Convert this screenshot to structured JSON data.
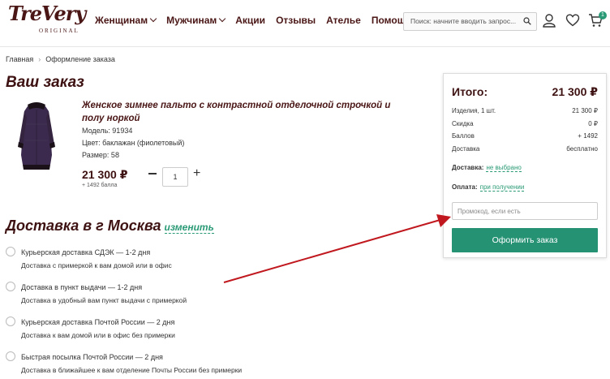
{
  "header": {
    "logo_text": "TreVery",
    "logo_sub": "ORIGINAL",
    "nav": [
      {
        "label": "Женщинам",
        "has_menu": true
      },
      {
        "label": "Мужчинам",
        "has_menu": true
      },
      {
        "label": "Акции",
        "has_menu": false
      },
      {
        "label": "Отзывы",
        "has_menu": false
      },
      {
        "label": "Ателье",
        "has_menu": false
      },
      {
        "label": "Помощь",
        "has_menu": true
      }
    ],
    "search_placeholder": "Поиск: начните вводить запрос...",
    "cart_count": "1",
    "icons": [
      "search-icon",
      "user-icon",
      "heart-icon",
      "cart-icon"
    ]
  },
  "breadcrumb": {
    "home": "Главная",
    "current": "Оформление заказа"
  },
  "order": {
    "title": "Ваш заказ",
    "product_name": "Женское зимнее пальто с контрастной отделочной строчкой и полу норкой",
    "model": "Модель: 91934",
    "color": "Цвет: баклажан (фиолетовый)",
    "size": "Размер: 58",
    "price": "21 300 ₽",
    "bonus": "+ 1492 балла",
    "quantity": "1"
  },
  "delivery": {
    "title": "Доставка в г Москва",
    "change_link": "изменить",
    "options": [
      {
        "title": "Курьерская доставка СДЭК — 1-2 дня",
        "desc": "Доставка с примеркой к вам домой или в офис"
      },
      {
        "title": "Доставка в пункт выдачи — 1-2 дня",
        "desc": "Доставка в удобный вам пункт выдачи с примеркой"
      },
      {
        "title": "Курьерская доставка Почтой России — 2 дня",
        "desc": "Доставка к вам домой или в офис без примерки"
      },
      {
        "title": "Быстрая посылка Почтой России — 2 дня",
        "desc": "Доставка в ближайшее к вам отделение Почты России без примерки"
      }
    ]
  },
  "summary": {
    "total_label": "Итого:",
    "total_value": "21 300 ₽",
    "rows": [
      {
        "label": "Изделия, 1 шт.",
        "value": "21 300 ₽"
      },
      {
        "label": "Скидка",
        "value": "0 ₽"
      },
      {
        "label": "Баллов",
        "value": "+ 1492"
      },
      {
        "label": "Доставка",
        "value": "бесплатно"
      }
    ],
    "delivery_label": "Доставка:",
    "delivery_value": "не выбрано",
    "payment_label": "Оплата:",
    "payment_value": "при получении",
    "promo_placeholder": "Промокод, если есть",
    "order_button": "Оформить заказ"
  },
  "colors": {
    "brand": "#4a1616",
    "accent": "#2a9a76",
    "button": "#259273",
    "annotation_arrow": "#c0181e"
  }
}
